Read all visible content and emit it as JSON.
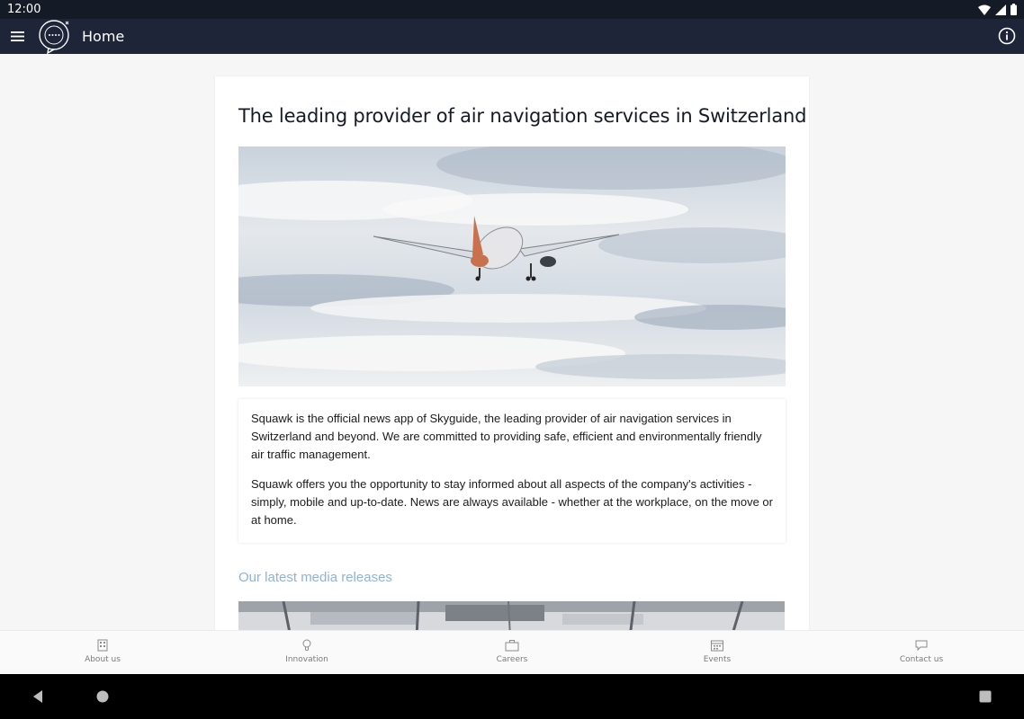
{
  "status_bar": {
    "time": "12:00"
  },
  "app_bar": {
    "title": "Home"
  },
  "card": {
    "headline": "The leading provider of air navigation services in Switzerland",
    "paragraphs": [
      "Squawk is the official news app of Skyguide, the leading provider of air navigation services in Switzerland and beyond. We are committed to providing safe, efficient and environmentally friendly air traffic management.",
      "Squawk offers you the opportunity to stay informed about all aspects of the company's activities - simply, mobile and up-to-date. News are always available - whether at the workplace, on the move or at home."
    ],
    "media_heading": "Our latest media releases"
  },
  "bottom_nav": {
    "items": [
      {
        "label": "About us",
        "icon": "building-icon"
      },
      {
        "label": "Innovation",
        "icon": "lightbulb-icon"
      },
      {
        "label": "Careers",
        "icon": "briefcase-icon"
      },
      {
        "label": "Events",
        "icon": "calendar-icon"
      },
      {
        "label": "Contact us",
        "icon": "chat-bubble-icon"
      }
    ]
  },
  "colors": {
    "app_bar_bg": "#1e2538",
    "status_bar_bg": "#141a26",
    "media_heading": "#8fb2dd",
    "page_bg": "#f6f6f6"
  }
}
